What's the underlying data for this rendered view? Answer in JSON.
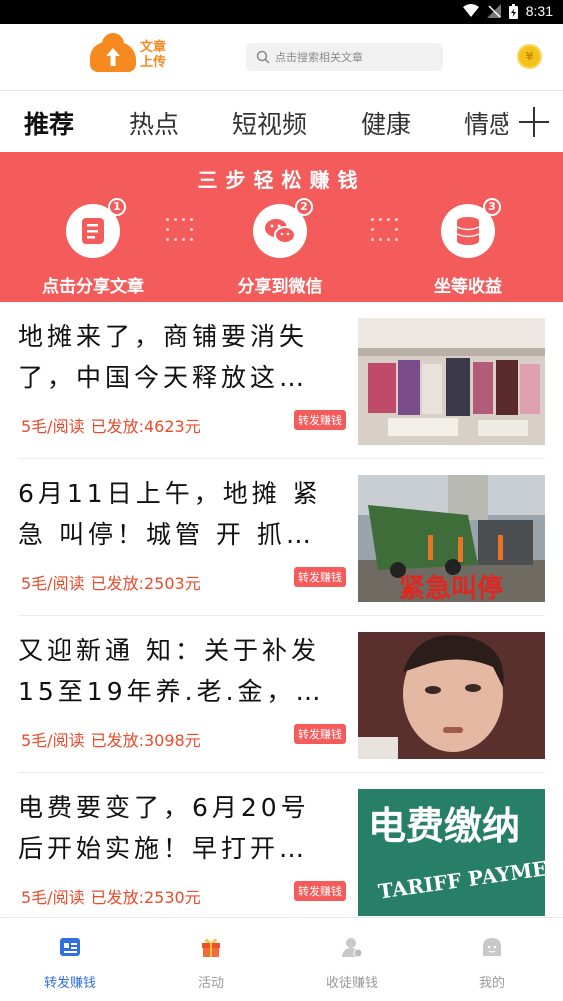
{
  "status_bar": {
    "time": "8:31"
  },
  "header": {
    "logo_line1": "文章",
    "logo_line2": "上传",
    "search_placeholder": "点击搜索相关文章",
    "coin_symbol": "¥"
  },
  "tabs": [
    {
      "label": "推荐",
      "active": true
    },
    {
      "label": "热点",
      "active": false
    },
    {
      "label": "短视频",
      "active": false
    },
    {
      "label": "健康",
      "active": false
    },
    {
      "label": "情感",
      "active": false
    }
  ],
  "banner": {
    "title": "三步轻松赚钱",
    "steps": [
      {
        "num": "1",
        "label": "点击分享文章",
        "icon": "document-icon"
      },
      {
        "num": "2",
        "label": "分享到微信",
        "icon": "wechat-icon"
      },
      {
        "num": "3",
        "label": "坐等收益",
        "icon": "coins-icon"
      }
    ]
  },
  "articles": [
    {
      "title": "地摊来了，商铺要消失了，中国今天释放这…",
      "rate": "5毛/阅读",
      "paid": "已发放:4623元",
      "badge": "转发赚钱"
    },
    {
      "title": "6月11日上午，地摊 紧急 叫停！城管 开 抓…",
      "rate": "5毛/阅读",
      "paid": "已发放:2503元",
      "badge": "转发赚钱",
      "overlay": "紧急叫停"
    },
    {
      "title": "又迎新通 知：关于补发15至19年养.老.金，…",
      "rate": "5毛/阅读",
      "paid": "已发放:3098元",
      "badge": "转发赚钱"
    },
    {
      "title": "电费要变了，6月20号后开始实施！早打开…",
      "rate": "5毛/阅读",
      "paid": "已发放:2530元",
      "badge": "转发赚钱",
      "sign_top": "电费缴纳",
      "sign_bottom": "TARIFF PAYMENT"
    }
  ],
  "bottom_nav": [
    {
      "label": "转发赚钱",
      "active": true
    },
    {
      "label": "活动",
      "active": false
    },
    {
      "label": "收徒赚钱",
      "active": false
    },
    {
      "label": "我的",
      "active": false
    }
  ],
  "colors": {
    "accent_red": "#f45b5b",
    "price_red": "#e94b2b",
    "logo_orange": "#f6891f",
    "nav_active": "#2f6fe0"
  }
}
